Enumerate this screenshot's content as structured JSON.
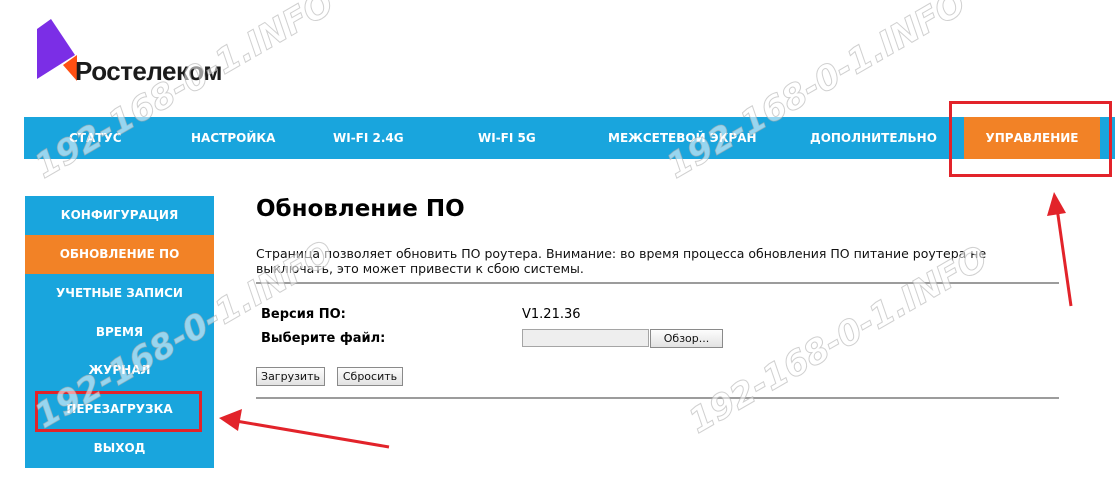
{
  "brand": {
    "name": "Ростелеком",
    "accent_color": "#19a5dd",
    "active_color": "#f28226",
    "logo_color": "#7b2ee6"
  },
  "topnav": {
    "items": [
      {
        "label": "СТАТУС"
      },
      {
        "label": "НАСТРОЙКА"
      },
      {
        "label": "WI-FI 2.4G"
      },
      {
        "label": "WI-FI 5G"
      },
      {
        "label": "МЕЖСЕТЕВОЙ ЭКРАН"
      },
      {
        "label": "ДОПОЛНИТЕЛЬНО"
      },
      {
        "label": "УПРАВЛЕНИЕ",
        "active": true
      }
    ]
  },
  "sidebar": {
    "items": [
      {
        "label": "КОНФИГУРАЦИЯ"
      },
      {
        "label": "ОБНОВЛЕНИЕ ПО",
        "active": true
      },
      {
        "label": "УЧЕТНЫЕ ЗАПИСИ"
      },
      {
        "label": "ВРЕМЯ"
      },
      {
        "label": "ЖУРНАЛ"
      },
      {
        "label": "ПЕРЕЗАГРУЗКА"
      },
      {
        "label": "ВЫХОД"
      }
    ]
  },
  "main": {
    "title": "Обновление ПО",
    "description": "Страница позволяет обновить ПО роутера. Внимание: во время процесса обновления ПО питание роутера не выключать, это может привести к сбою системы.",
    "firmware_label": "Версия ПО:",
    "firmware_version": "V1.21.36",
    "file_label": "Выберите файл:",
    "file_value": "",
    "browse_button": "Обзор...",
    "upload_button": "Загрузить",
    "reset_button": "Сбросить"
  },
  "annotations": {
    "highlight_color": "#e2232a",
    "watermark": "192-168-0-1.INFO"
  }
}
